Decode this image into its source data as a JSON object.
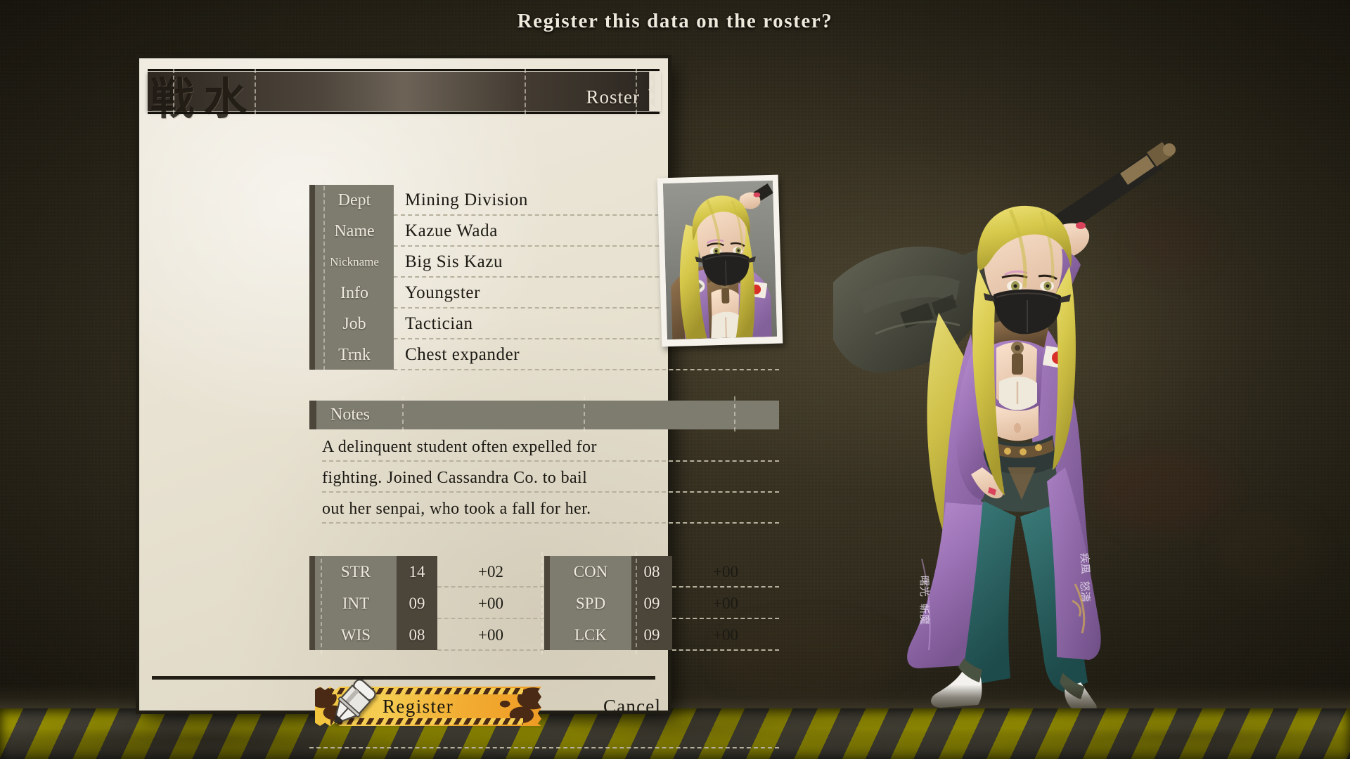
{
  "dialog": {
    "title": "Register this data on the roster?"
  },
  "card": {
    "header": {
      "kanji": "戦 水",
      "title": "Roster"
    },
    "info": {
      "rows": [
        {
          "label": "Dept",
          "value": "Mining Division"
        },
        {
          "label": "Name",
          "value": "Kazue Wada"
        },
        {
          "label": "Nickname",
          "value": "Big Sis Kazu"
        },
        {
          "label": "Info",
          "value": "Youngster"
        },
        {
          "label": "Job",
          "value": "Tactician"
        },
        {
          "label": "Trnk",
          "value": "Chest expander"
        }
      ],
      "portrait_alt": "portrait-kazue-wada"
    },
    "notes": {
      "header": "Notes",
      "lines": [
        "A delinquent student often expelled for",
        "fighting. Joined Cassandra Co. to bail",
        "out her senpai, who took a fall for her."
      ]
    },
    "stats": {
      "left": [
        {
          "name": "STR",
          "value": "14",
          "mod": "+02"
        },
        {
          "name": "INT",
          "value": "09",
          "mod": "+00"
        },
        {
          "name": "WIS",
          "value": "08",
          "mod": "+00"
        }
      ],
      "right": [
        {
          "name": "CON",
          "value": "08",
          "mod": "+00"
        },
        {
          "name": "SPD",
          "value": "09",
          "mod": "+00"
        },
        {
          "name": "LCK",
          "value": "09",
          "mod": "+00"
        }
      ]
    },
    "footer": {
      "register_label": "Register",
      "cancel_label": "Cancel",
      "register_icon": "pen-icon"
    }
  },
  "theme": {
    "background": "#2a2519",
    "card_paper": "#e9e4d5",
    "label_gray": "#7e7c6f",
    "dark_slot": "#4b453a",
    "ink": "#1c1a14",
    "cream_text": "#eee9dc",
    "ticket_yellow": "#f2c23a",
    "ticket_orange": "#ee9b24",
    "hazard_yellow": "#d8d000",
    "hazard_gray": "#5d5a4e"
  },
  "character": {
    "name": "kazue-wada-full-body",
    "hair": "#d9cf4a",
    "coat": "#a178b8",
    "coat_dark": "#7c5a93",
    "pants": "#2d6060",
    "leather": "#7d6145",
    "mask": "#23211f",
    "flag": "#d83028"
  }
}
